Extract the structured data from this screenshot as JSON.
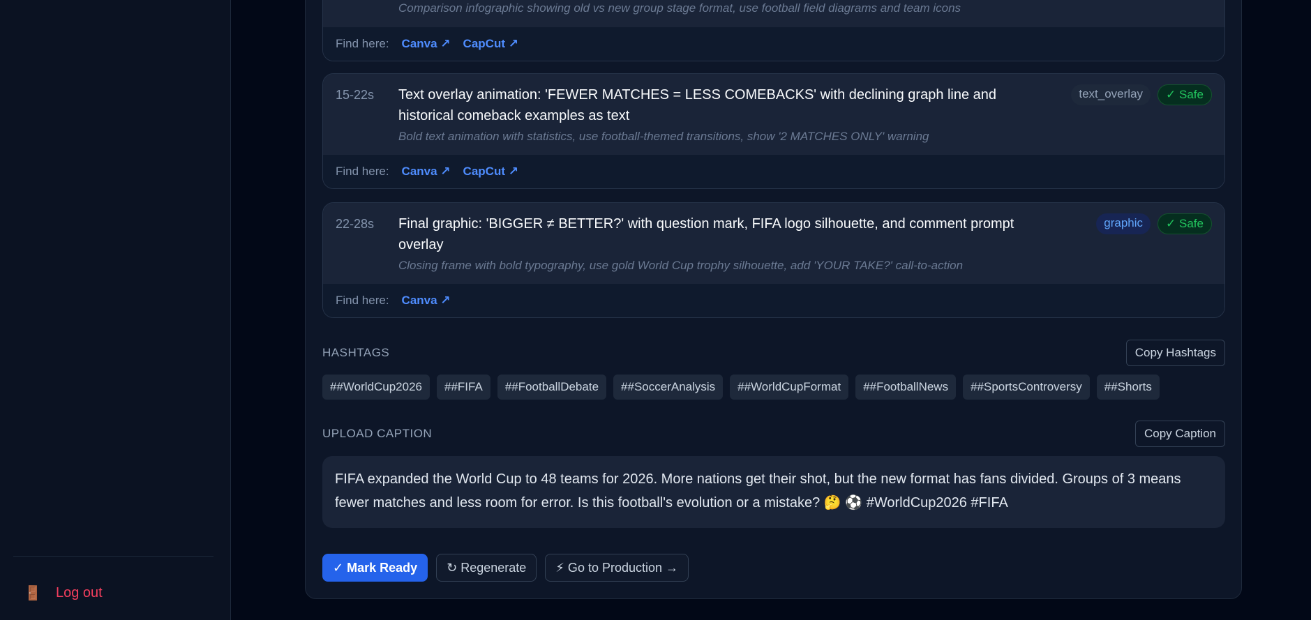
{
  "sidebar": {
    "logout_icon": "door-icon",
    "logout_label": "Log out"
  },
  "shots": [
    {
      "note": "Comparison infographic showing old vs new group stage format, use football field diagrams and team icons",
      "find_label": "Find here:",
      "links": [
        "Canva ↗",
        "CapCut ↗"
      ]
    },
    {
      "time": "15-22s",
      "desc": "Text overlay animation: 'FEWER MATCHES = LESS COMEBACKS' with declining graph line and historical comeback examples as text",
      "note": "Bold text animation with statistics, use football-themed transitions, show '2 MATCHES ONLY' warning",
      "type": "text_overlay",
      "safe": "✓ Safe",
      "find_label": "Find here:",
      "links": [
        "Canva ↗",
        "CapCut ↗"
      ]
    },
    {
      "time": "22-28s",
      "desc": "Final graphic: 'BIGGER ≠ BETTER?' with question mark, FIFA logo silhouette, and comment prompt overlay",
      "note": "Closing frame with bold typography, use gold World Cup trophy silhouette, add 'YOUR TAKE?' call-to-action",
      "type": "graphic",
      "safe": "✓ Safe",
      "find_label": "Find here:",
      "links": [
        "Canva ↗"
      ]
    }
  ],
  "hashtags": {
    "label": "HASHTAGS",
    "copy_label": "Copy Hashtags",
    "tags": [
      "##WorldCup2026",
      "##FIFA",
      "##FootballDebate",
      "##SoccerAnalysis",
      "##WorldCupFormat",
      "##FootballNews",
      "##SportsControversy",
      "##Shorts"
    ]
  },
  "caption": {
    "label": "UPLOAD CAPTION",
    "copy_label": "Copy Caption",
    "text": "FIFA expanded the World Cup to 48 teams for 2026. More nations get their shot, but the new format has fans divided. Groups of 3 means fewer matches and less room for error. Is this football's evolution or a mistake? 🤔 ⚽ #WorldCup2026 #FIFA"
  },
  "actions": {
    "mark_ready": "✓ Mark Ready",
    "regenerate": "↻ Regenerate",
    "go_production": "⚡ Go to Production →"
  },
  "colors": {
    "accent": "#2563eb",
    "link": "#4f8dff",
    "safe": "#22c55e",
    "danger": "#f43f5e"
  }
}
